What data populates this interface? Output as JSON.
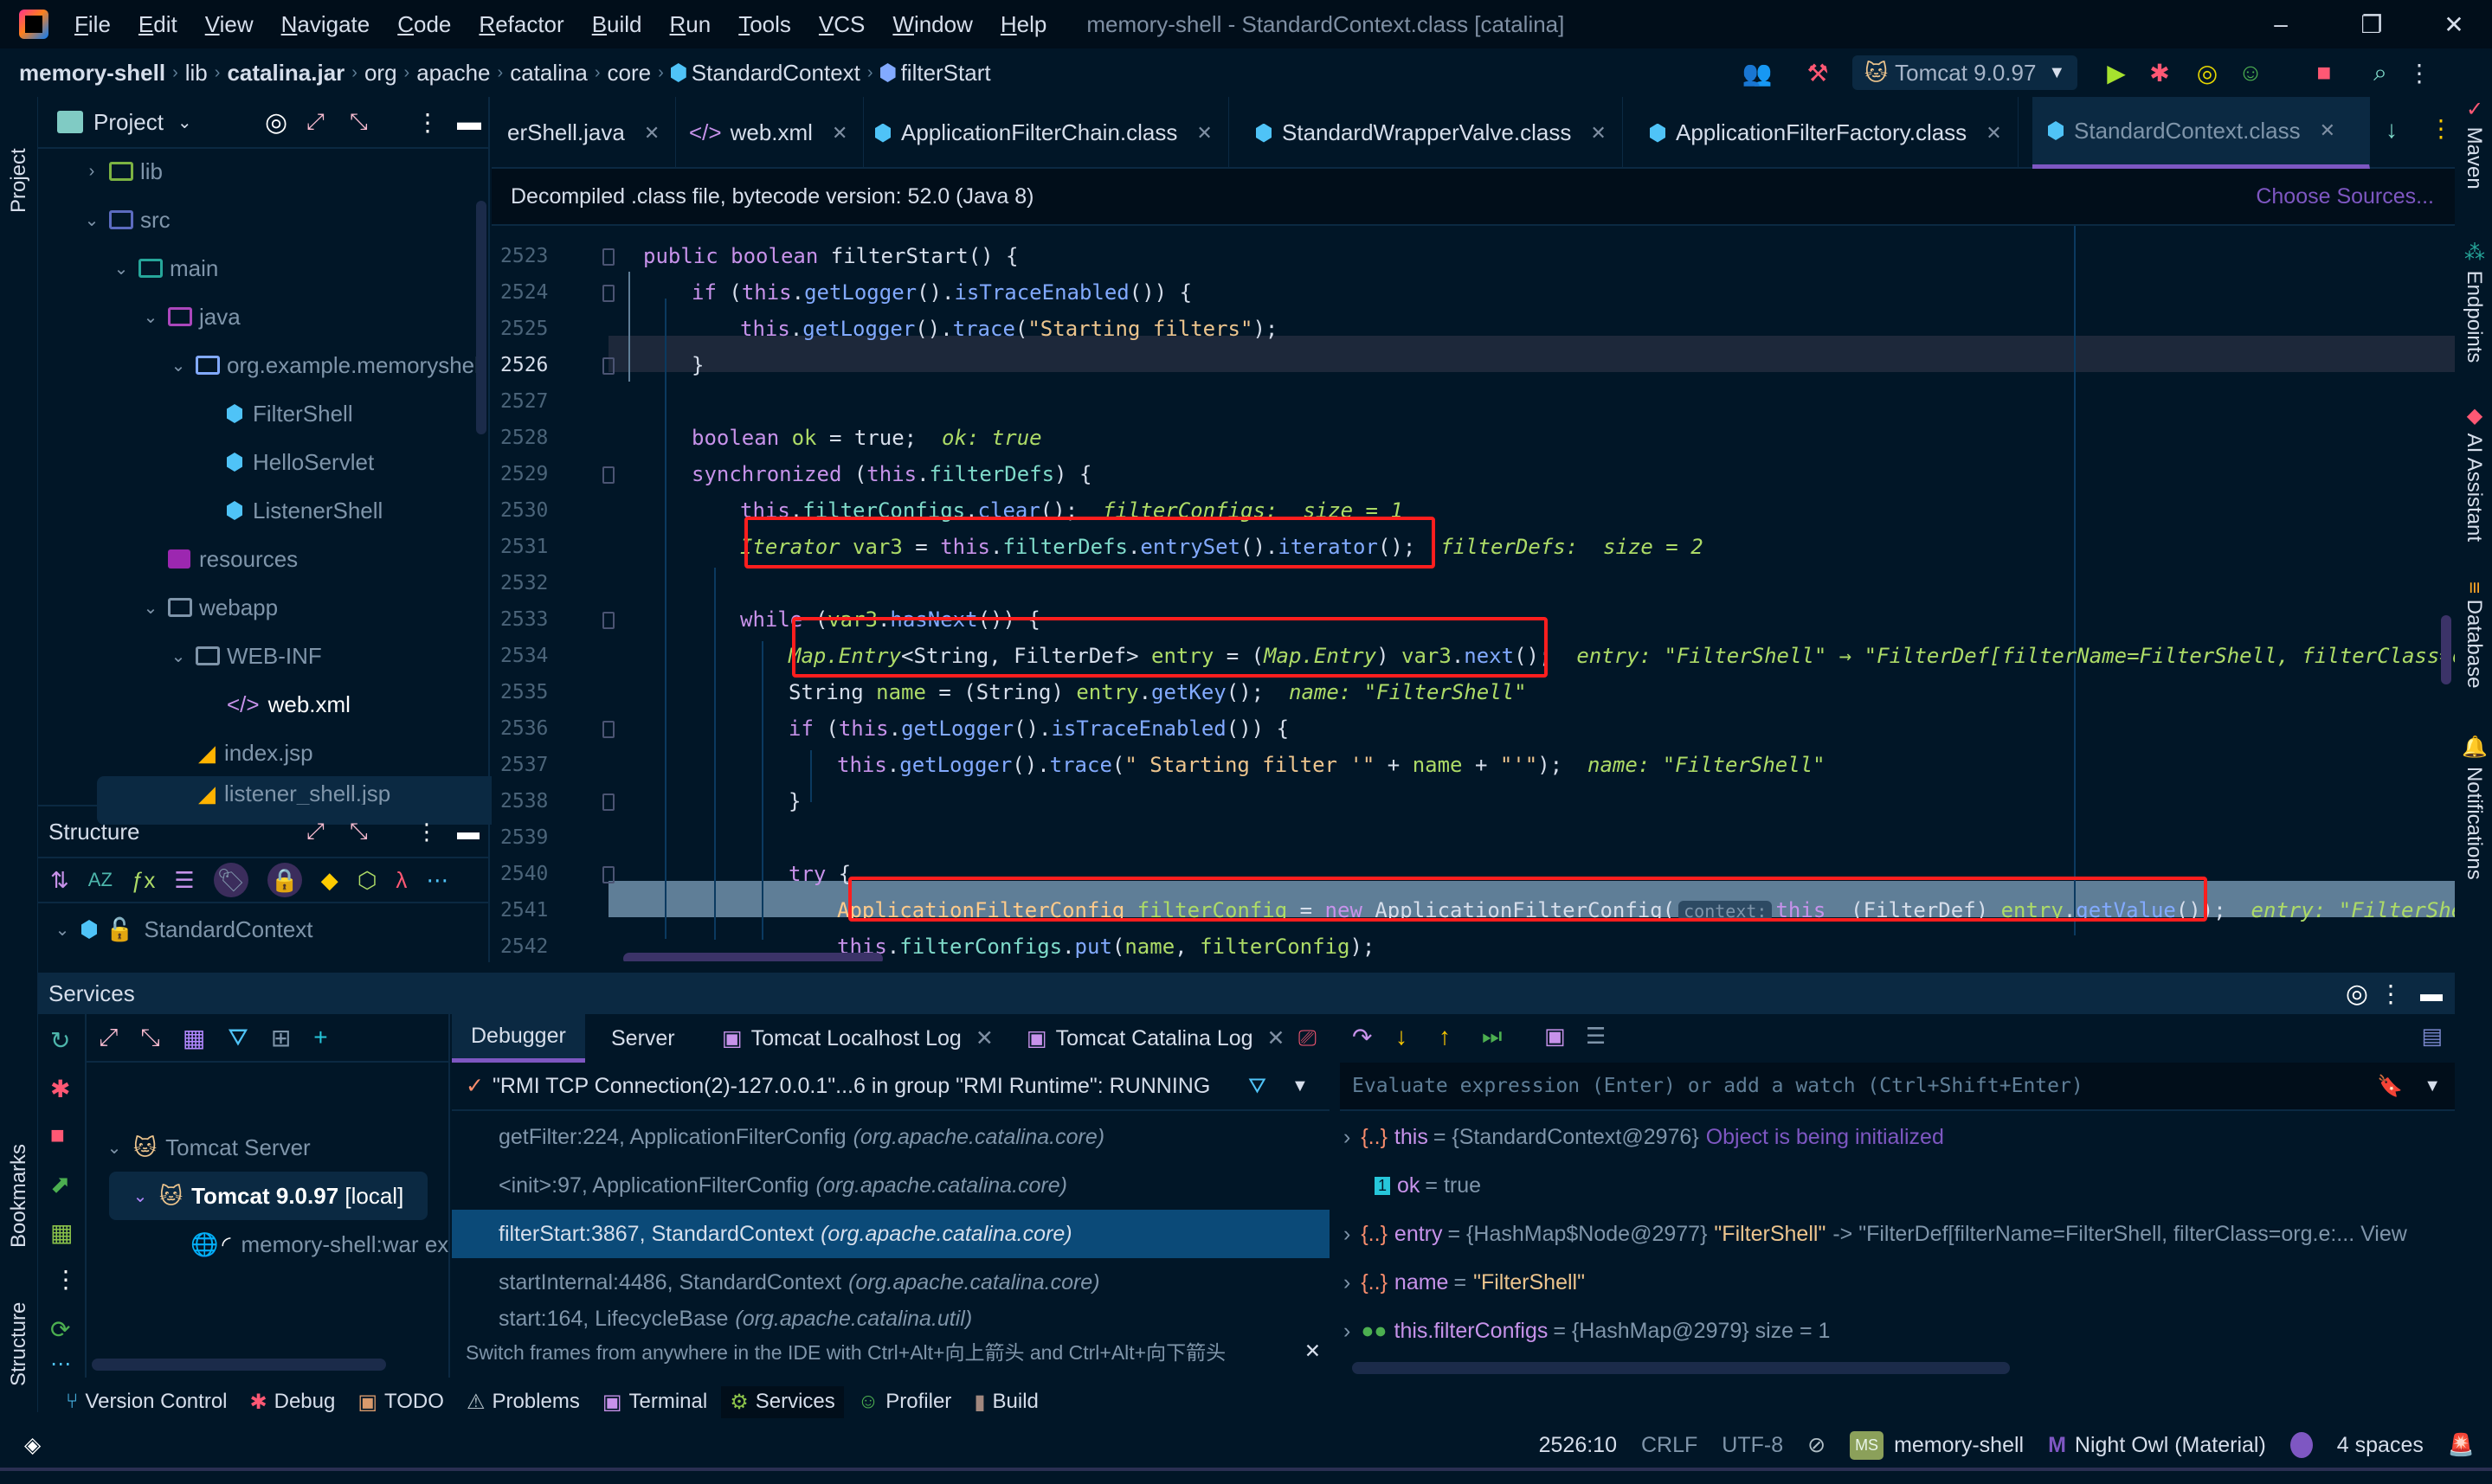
{
  "window": {
    "title": "memory-shell - StandardContext.class [catalina]",
    "menu": [
      "File",
      "Edit",
      "View",
      "Navigate",
      "Code",
      "Refactor",
      "Build",
      "Run",
      "Tools",
      "VCS",
      "Window",
      "Help"
    ],
    "controls": {
      "minimize": "–",
      "restore": "❐",
      "close": "✕"
    }
  },
  "navbar": {
    "breadcrumbs": [
      "memory-shell",
      "lib",
      "catalina.jar",
      "org",
      "apache",
      "catalina",
      "core",
      "StandardContext",
      "filterStart"
    ],
    "run_config": "Tomcat 9.0.97",
    "icons": [
      "code-with-me-icon",
      "build-hammer-icon",
      "run-icon",
      "debug-icon",
      "coverage-icon",
      "profile-icon",
      "stop-icon",
      "search-icon",
      "more-icon",
      "jetbrains-ai-icon"
    ]
  },
  "left_strip": {
    "project_label": "Project",
    "bookmarks_label": "Bookmarks",
    "structure_label": "Structure"
  },
  "project_panel": {
    "title": "Project",
    "tree": [
      {
        "label": "lib",
        "depth": 1,
        "expanded": false,
        "icon": "library-folder-icon"
      },
      {
        "label": "src",
        "depth": 1,
        "expanded": true,
        "icon": "source-folder-icon"
      },
      {
        "label": "main",
        "depth": 2,
        "expanded": true,
        "icon": "module-folder-icon"
      },
      {
        "label": "java",
        "depth": 3,
        "expanded": true,
        "icon": "java-folder-icon"
      },
      {
        "label": "org.example.memoryshell",
        "depth": 4,
        "expanded": true,
        "icon": "package-folder-icon"
      },
      {
        "label": "FilterShell",
        "depth": 5,
        "icon": "class-icon"
      },
      {
        "label": "HelloServlet",
        "depth": 5,
        "icon": "class-icon"
      },
      {
        "label": "ListenerShell",
        "depth": 5,
        "icon": "class-icon"
      },
      {
        "label": "resources",
        "depth": 3,
        "icon": "resources-folder-icon"
      },
      {
        "label": "webapp",
        "depth": 3,
        "expanded": true,
        "icon": "folder-icon"
      },
      {
        "label": "WEB-INF",
        "depth": 4,
        "expanded": true,
        "icon": "folder-icon"
      },
      {
        "label": "web.xml",
        "depth": 5,
        "selected": true,
        "icon": "xml-icon"
      },
      {
        "label": "index.jsp",
        "depth": 4,
        "icon": "jsp-icon"
      },
      {
        "label": "listener_shell.jsp",
        "depth": 4,
        "icon": "jsp-icon"
      }
    ]
  },
  "structure_panel": {
    "title": "Structure",
    "root": "StandardContext"
  },
  "editor": {
    "tabs": [
      {
        "label": "erShell.java",
        "active": false
      },
      {
        "label": "web.xml",
        "active": false
      },
      {
        "label": "ApplicationFilterChain.class",
        "active": false
      },
      {
        "label": "StandardWrapperValve.class",
        "active": false
      },
      {
        "label": "ApplicationFilterFactory.class",
        "active": false
      },
      {
        "label": "StandardContext.class",
        "active": true
      }
    ],
    "info_bar": "Decompiled .class file, bytecode version: 52.0 (Java 8)",
    "choose_sources": "Choose Sources...",
    "current_line": 2526,
    "execution_line": 2541,
    "lines": [
      {
        "n": 2523,
        "text": "public boolean filterStart() {"
      },
      {
        "n": 2524,
        "text": "if (this.getLogger().isTraceEnabled()) {"
      },
      {
        "n": 2525,
        "text": "this.getLogger().trace(\"Starting filters\");"
      },
      {
        "n": 2526,
        "text": "}"
      },
      {
        "n": 2527,
        "text": ""
      },
      {
        "n": 2528,
        "text": "boolean ok = true;",
        "hint": "ok: true"
      },
      {
        "n": 2529,
        "text": "synchronized (this.filterDefs) {"
      },
      {
        "n": 2530,
        "text": "this.filterConfigs.clear();",
        "hint": "filterConfigs:  size = 1"
      },
      {
        "n": 2531,
        "text": "Iterator var3 = this.filterDefs.entrySet().iterator();",
        "hint": "filterDefs:  size = 2"
      },
      {
        "n": 2532,
        "text": ""
      },
      {
        "n": 2533,
        "text": "while (var3.hasNext()) {"
      },
      {
        "n": 2534,
        "text": "Map.Entry<String, FilterDef> entry = (Map.Entry) var3.next();",
        "hint": "entry: \"FilterShell\" → \"FilterDef[filterName=FilterShell, filterClass=o"
      },
      {
        "n": 2535,
        "text": "String name = (String) entry.getKey();",
        "hint": "name: \"FilterShell\""
      },
      {
        "n": 2536,
        "text": "if (this.getLogger().isTraceEnabled()) {"
      },
      {
        "n": 2537,
        "text": "this.getLogger().trace(\" Starting filter '\" + name + \"'\");",
        "hint": "name: \"FilterShell\""
      },
      {
        "n": 2538,
        "text": "}"
      },
      {
        "n": 2539,
        "text": ""
      },
      {
        "n": 2540,
        "text": "try {"
      },
      {
        "n": 2541,
        "text": "ApplicationFilterConfig filterConfig = new ApplicationFilterConfig(",
        "param_hint": "context:",
        "text2": "this  (FilterDef) entry.getValue());",
        "hint": "entry: \"FilterShel"
      },
      {
        "n": 2542,
        "text": "this.filterConfigs.put(name, filterConfig);"
      }
    ]
  },
  "right_strip": [
    "Maven",
    "Endpoints",
    "AI Assistant",
    "Database",
    "Notifications"
  ],
  "services": {
    "title": "Services",
    "tree": [
      {
        "label": "Tomcat Server",
        "depth": 0
      },
      {
        "label": "Tomcat 9.0.97",
        "suffix": "[local]",
        "depth": 1,
        "selected": true
      },
      {
        "label": "memory-shell:war ex",
        "depth": 2
      }
    ],
    "tabs": [
      {
        "label": "Debugger",
        "active": true
      },
      {
        "label": "Server"
      },
      {
        "label": "Tomcat Localhost Log",
        "closable": true
      },
      {
        "label": "Tomcat Catalina Log",
        "closable": true
      }
    ],
    "thread": "\"RMI TCP Connection(2)-127.0.0.1\"...6 in group \"RMI Runtime\": RUNNING",
    "frames": [
      {
        "method": "getFilter:224, ApplicationFilterConfig",
        "pkg": "(org.apache.catalina.core)"
      },
      {
        "method": "<init>:97, ApplicationFilterConfig",
        "pkg": "(org.apache.catalina.core)"
      },
      {
        "method": "filterStart:3867, StandardContext",
        "pkg": "(org.apache.catalina.core)",
        "selected": true
      },
      {
        "method": "startInternal:4486, StandardContext",
        "pkg": "(org.apache.catalina.core)"
      },
      {
        "method": "start:164, LifecycleBase",
        "pkg": "(org.apache.catalina.util)"
      }
    ],
    "frames_hint": "Switch frames from anywhere in the IDE with Ctrl+Alt+向上箭头 and Ctrl+Alt+向下箭头",
    "eval_placeholder": "Evaluate expression (Enter) or add a watch (Ctrl+Shift+Enter)",
    "variables": [
      {
        "name": "this",
        "value": "= {StandardContext@2976}",
        "extra": "Object is being initialized",
        "icon": "object-icon",
        "expandable": true
      },
      {
        "name": "ok",
        "value": "= true",
        "icon": "primitive-icon",
        "expandable": false
      },
      {
        "name": "entry",
        "value": "= {HashMap$Node@2977}",
        "str": "\"FilterShell\"",
        "extra": "-> \"FilterDef[filterName=FilterShell, filterClass=org.e:... View",
        "icon": "object-icon",
        "expandable": true
      },
      {
        "name": "name",
        "value": "=",
        "str": "\"FilterShell\"",
        "icon": "object-icon",
        "expandable": true
      },
      {
        "name": "this.filterConfigs",
        "value": "= {HashMap@2979}  size = 1",
        "icon": "watch-icon",
        "expandable": true
      }
    ]
  },
  "bottom_toolbar": [
    {
      "label": "Version Control",
      "icon": "vcs-icon"
    },
    {
      "label": "Debug",
      "icon": "debug-icon"
    },
    {
      "label": "TODO",
      "icon": "todo-icon"
    },
    {
      "label": "Problems",
      "icon": "problems-icon"
    },
    {
      "label": "Terminal",
      "icon": "terminal-icon"
    },
    {
      "label": "Services",
      "icon": "services-icon",
      "active": true
    },
    {
      "label": "Profiler",
      "icon": "profiler-icon"
    },
    {
      "label": "Build",
      "icon": "build-icon"
    }
  ],
  "status_bar": {
    "position": "2526:10",
    "line_sep": "CRLF",
    "encoding": "UTF-8",
    "project_badge": "MS",
    "project": "memory-shell",
    "theme": "Night Owl (Material)",
    "indent": "4 spaces"
  }
}
